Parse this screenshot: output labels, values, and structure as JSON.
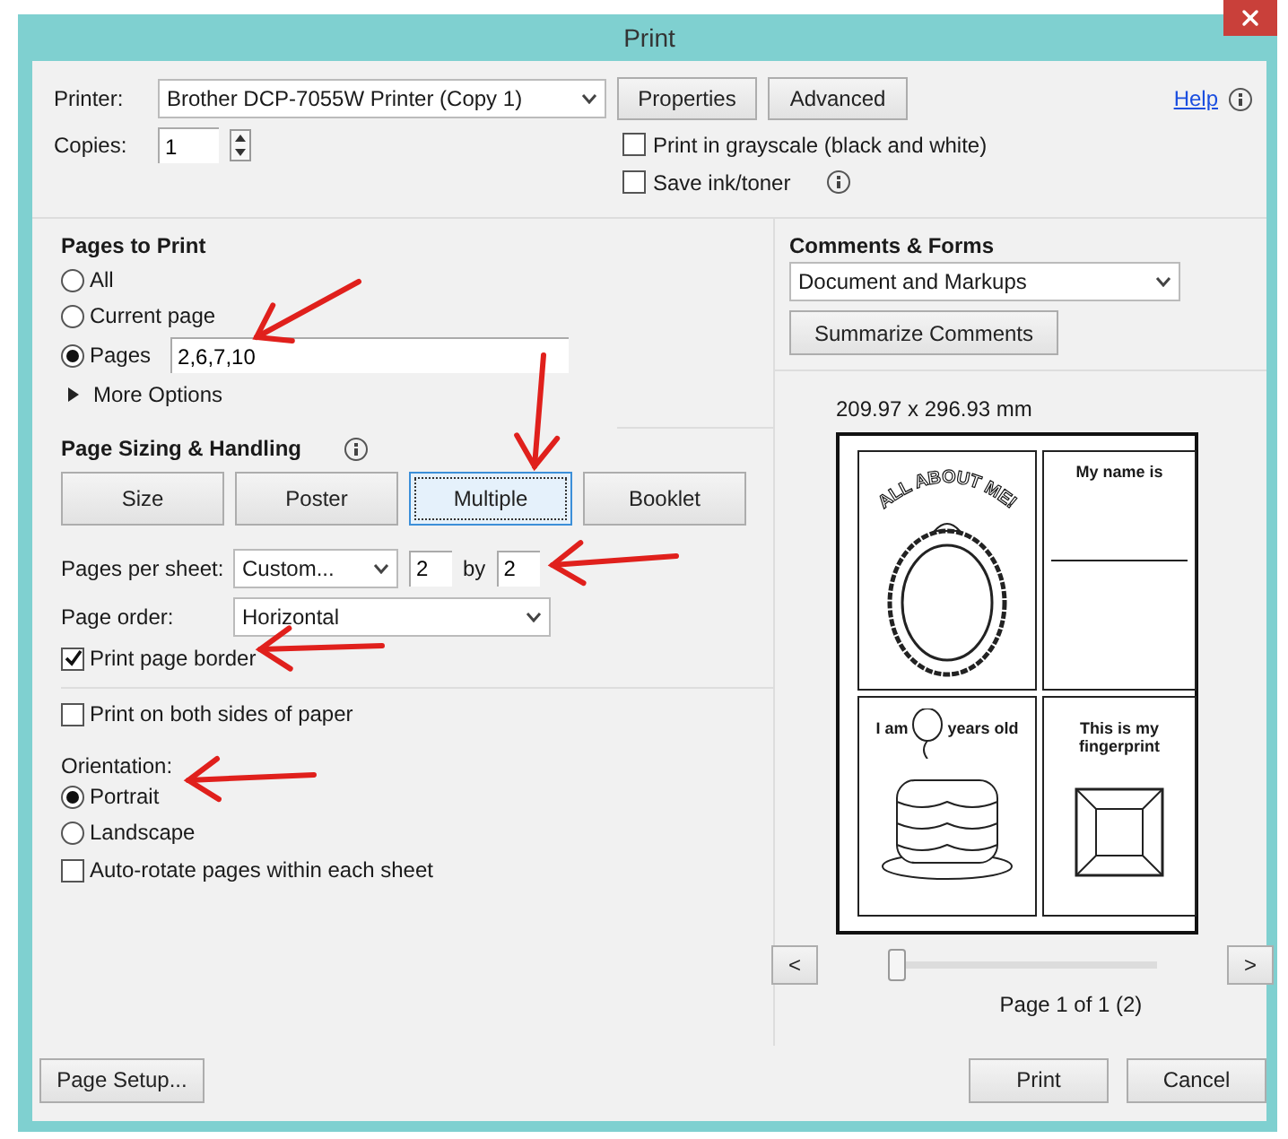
{
  "window": {
    "title": "Print"
  },
  "printer": {
    "label": "Printer:",
    "value": "Brother DCP-7055W Printer (Copy 1)",
    "buttons": [
      "Properties",
      "Advanced"
    ]
  },
  "help": {
    "label": "Help"
  },
  "copies": {
    "label": "Copies:",
    "value": "1"
  },
  "print_options": [
    {
      "label": "Print in grayscale (black and white)",
      "checked": false,
      "info": false
    },
    {
      "label": "Save ink/toner",
      "checked": false,
      "info": true
    }
  ],
  "pages_to_print": {
    "title": "Pages to Print",
    "options": [
      {
        "label": "All",
        "selected": false
      },
      {
        "label": "Current page",
        "selected": false
      },
      {
        "label": "Pages",
        "selected": true
      }
    ],
    "pages_value": "2,6,7,10",
    "more_options": "More Options"
  },
  "page_sizing": {
    "title": "Page Sizing & Handling",
    "modes": [
      {
        "label": "Size",
        "selected": false
      },
      {
        "label": "Poster",
        "selected": false
      },
      {
        "label": "Multiple",
        "selected": true
      },
      {
        "label": "Booklet",
        "selected": false
      }
    ],
    "pages_per_sheet": {
      "label": "Pages per sheet:",
      "value": "Custom...",
      "columns": "2",
      "by": "by",
      "rows": "2"
    },
    "page_order": {
      "label": "Page order:",
      "value": "Horizontal"
    },
    "print_page_border": {
      "label": "Print page border",
      "checked": true
    },
    "both_sides": {
      "label": "Print on both sides of paper",
      "checked": false
    },
    "orientation": {
      "label": "Orientation:",
      "options": [
        {
          "label": "Portrait",
          "selected": true
        },
        {
          "label": "Landscape",
          "selected": false
        }
      ]
    },
    "auto_rotate": {
      "label": "Auto-rotate pages within each sheet",
      "checked": false
    }
  },
  "comments_forms": {
    "title": "Comments & Forms",
    "value": "Document and Markups",
    "button": "Summarize Comments"
  },
  "preview": {
    "size": "209.97 x 296.93 mm",
    "pages": [
      {
        "kind": "about",
        "title": "ALL ABOUT ME!"
      },
      {
        "kind": "name",
        "text": "My name is"
      },
      {
        "kind": "age",
        "before": "I am",
        "after": "years old"
      },
      {
        "kind": "fingerprint",
        "text": "This is my fingerprint"
      }
    ],
    "prev": "<",
    "next": ">",
    "slider": {
      "level": 0
    },
    "page_label": "Page 1 of 1 (2)"
  },
  "footer": {
    "page_setup": "Page Setup...",
    "print": "Print",
    "cancel": "Cancel"
  }
}
